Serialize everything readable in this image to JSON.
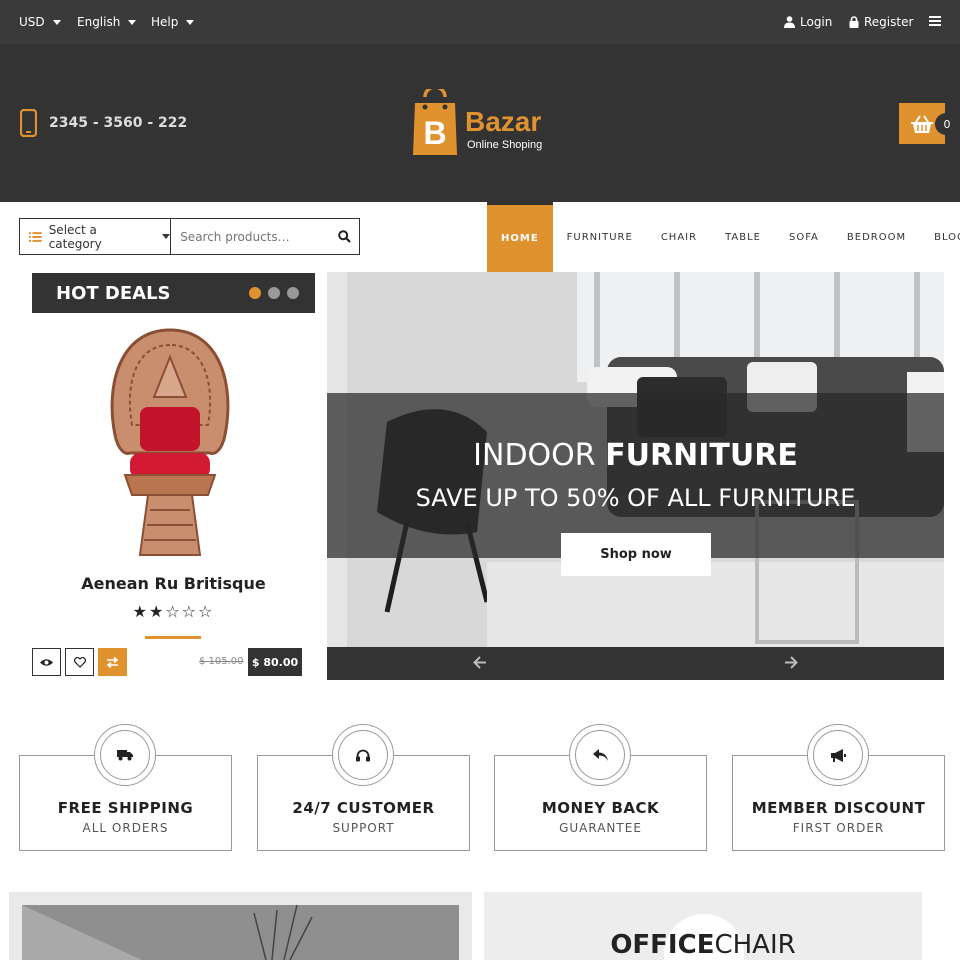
{
  "topbar": {
    "currency": "USD",
    "language": "English",
    "help": "Help",
    "login": "Login",
    "register": "Register"
  },
  "header": {
    "phone": "2345 - 3560 - 222",
    "logo_letter": "B",
    "logo_name": "Bazar",
    "logo_tagline": "Online Shoping",
    "cart_count": "0"
  },
  "search": {
    "category_label": "Select a category",
    "placeholder": "Search products…"
  },
  "nav": {
    "items": [
      "HOME",
      "FURNITURE",
      "CHAIR",
      "TABLE",
      "SOFA",
      "BEDROOM",
      "BLOG"
    ]
  },
  "hot_deals": {
    "title": "HOT DEALS",
    "product_name": "Aenean Ru Britisque",
    "rating": "★★☆☆☆",
    "old_price": "$ 105.00",
    "new_price": "$ 80.00"
  },
  "hero": {
    "title_light": "INDOOR",
    "title_bold": "FURNITURE",
    "subtitle": "SAVE UP TO 50% OF ALL FURNITURE",
    "button": "Shop now"
  },
  "features": [
    {
      "title": "FREE SHIPPING",
      "sub": "ALL ORDERS",
      "icon": "truck-icon"
    },
    {
      "title": "24/7 CUSTOMER",
      "sub": "SUPPORT",
      "icon": "headphones-icon"
    },
    {
      "title": "MONEY BACK",
      "sub": "GUARANTEE",
      "icon": "reply-arrow-icon"
    },
    {
      "title": "MEMBER DISCOUNT",
      "sub": "FIRST ORDER",
      "icon": "megaphone-icon"
    }
  ],
  "banners": {
    "office_bold": "OFFICE",
    "office_light": "CHAIR"
  },
  "colors": {
    "accent": "#e0922f",
    "dark": "#333333",
    "topbar": "#3a3a3a"
  }
}
